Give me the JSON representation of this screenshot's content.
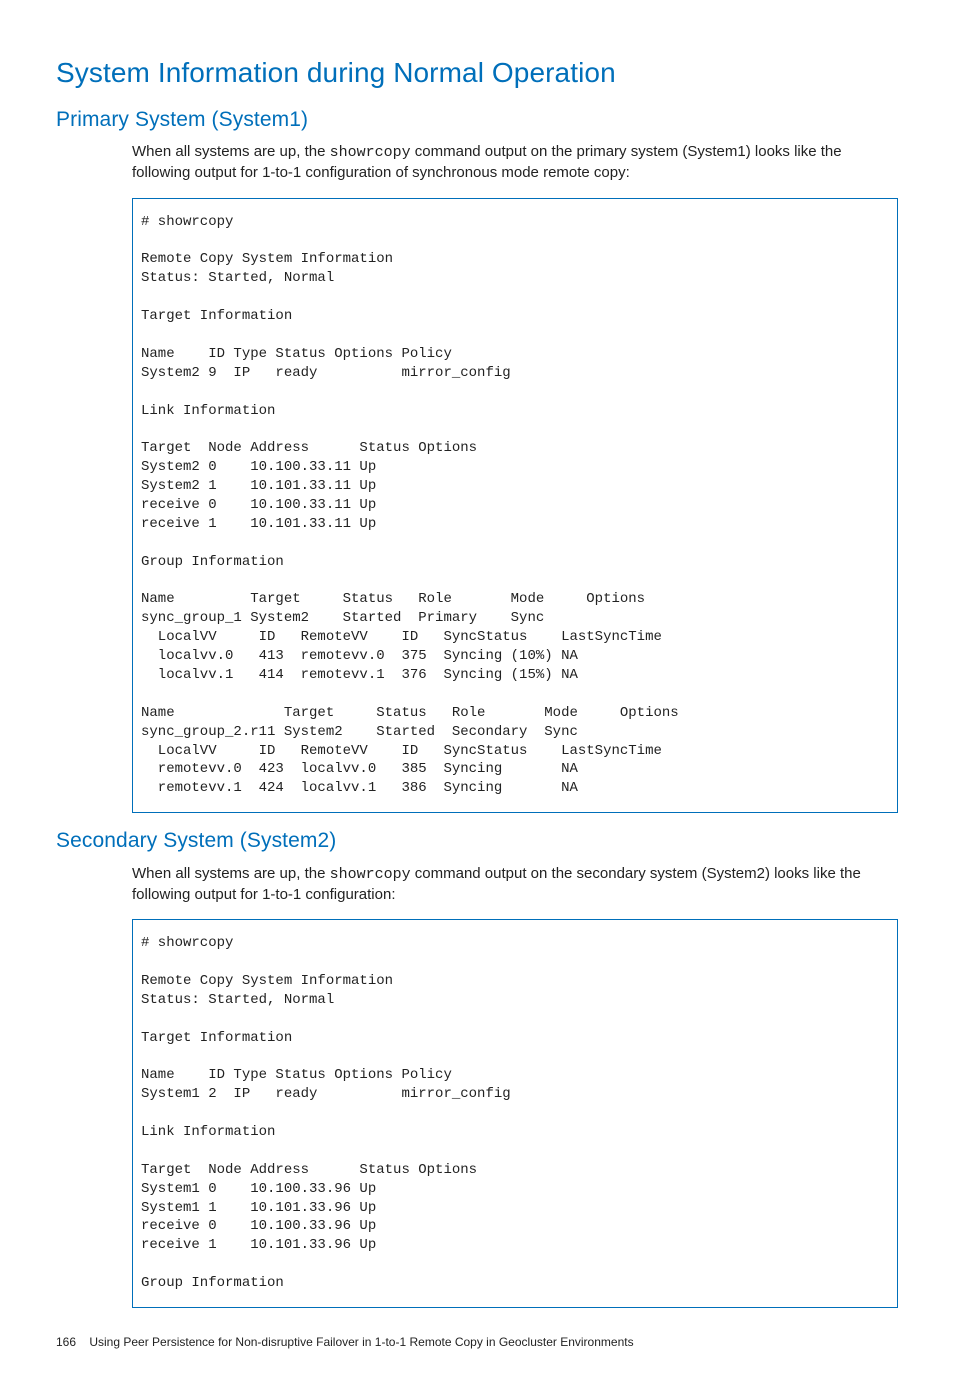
{
  "heading_main": "System Information during Normal Operation",
  "section1": {
    "heading": "Primary System (System1)",
    "para_part1": "When all systems are up, the ",
    "para_cmd": "showrcopy",
    "para_part2": " command output on the primary system (System1) looks like the following output for 1-to-1 configuration of synchronous mode remote copy:",
    "code": "# showrcopy\n\nRemote Copy System Information\nStatus: Started, Normal\n\nTarget Information\n\nName    ID Type Status Options Policy\nSystem2 9  IP   ready          mirror_config\n\nLink Information\n\nTarget  Node Address      Status Options\nSystem2 0    10.100.33.11 Up\nSystem2 1    10.101.33.11 Up\nreceive 0    10.100.33.11 Up\nreceive 1    10.101.33.11 Up\n\nGroup Information\n\nName         Target     Status   Role       Mode     Options\nsync_group_1 System2    Started  Primary    Sync\n  LocalVV     ID   RemoteVV    ID   SyncStatus    LastSyncTime\n  localvv.0   413  remotevv.0  375  Syncing (10%) NA\n  localvv.1   414  remotevv.1  376  Syncing (15%) NA\n\nName             Target     Status   Role       Mode     Options\nsync_group_2.r11 System2    Started  Secondary  Sync\n  LocalVV     ID   RemoteVV    ID   SyncStatus    LastSyncTime\n  remotevv.0  423  localvv.0   385  Syncing       NA\n  remotevv.1  424  localvv.1   386  Syncing       NA"
  },
  "section2": {
    "heading": "Secondary System (System2)",
    "para_part1": "When all systems are up, the ",
    "para_cmd": "showrcopy",
    "para_part2": " command output on the secondary system (System2) looks like the following output for 1-to-1 configuration:",
    "code": "# showrcopy\n\nRemote Copy System Information\nStatus: Started, Normal\n\nTarget Information\n\nName    ID Type Status Options Policy\nSystem1 2  IP   ready          mirror_config\n\nLink Information\n\nTarget  Node Address      Status Options\nSystem1 0    10.100.33.96 Up\nSystem1 1    10.101.33.96 Up\nreceive 0    10.100.33.96 Up\nreceive 1    10.101.33.96 Up\n\nGroup Information"
  },
  "footer": {
    "page": "166",
    "text": "Using Peer Persistence for Non-disruptive Failover in 1-to-1 Remote Copy in Geocluster Environments"
  }
}
